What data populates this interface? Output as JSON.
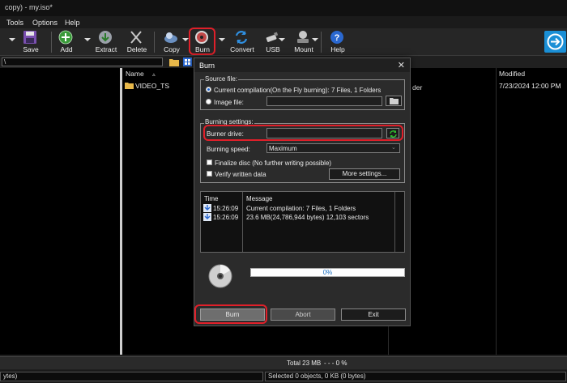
{
  "window": {
    "title": "copy) - my.iso*"
  },
  "menu": {
    "items": [
      "Tools",
      "Options",
      "Help"
    ]
  },
  "toolbar": {
    "save": "Save",
    "add": "Add",
    "extract": "Extract",
    "delete": "Delete",
    "copy": "Copy",
    "burn": "Burn",
    "convert": "Convert",
    "usb": "USB",
    "mount": "Mount",
    "help": "Help"
  },
  "address": {
    "value": "\\"
  },
  "filelist": {
    "columns": {
      "name": "Name",
      "modified": "Modified",
      "type_partial": "der"
    },
    "rows": [
      {
        "name": "VIDEO_TS",
        "modified": "7/23/2024 12:00 PM"
      }
    ]
  },
  "status": {
    "total": "Total  23 MB",
    "percent": "- - -  0 %",
    "left": "ytes)",
    "selected": "Selected 0 objects, 0 KB (0 bytes)"
  },
  "dialog": {
    "title": "Burn",
    "close": "✕",
    "source_group": "Source file:",
    "current_compilation": "Current compilation(On the Fly burning):  7 Files, 1 Folders",
    "image_file": "Image file:",
    "image_file_value": "",
    "burning_group": "Burning settings:",
    "burner_drive": "Burner drive:",
    "burner_drive_value": "",
    "burning_speed": "Burning speed:",
    "burning_speed_value": "Maximum",
    "finalize": "Finalize disc (No further writing possible)",
    "verify": "Verify written data",
    "more_settings": "More settings...",
    "log_headers": {
      "time": "Time",
      "message": "Message"
    },
    "log_rows": [
      {
        "time": "15:26:09",
        "message": "Current compilation: 7 Files, 1 Folders"
      },
      {
        "time": "15:26:09",
        "message": "23.6 MB(24,786,944 bytes)   12,103 sectors"
      }
    ],
    "progress_text": "0%",
    "progress_fraction": 0,
    "burn_button": "Burn",
    "abort_button": "Abort",
    "exit_button": "Exit"
  },
  "colors": {
    "highlight": "#e0202a",
    "accent": "#1a8fd6"
  }
}
